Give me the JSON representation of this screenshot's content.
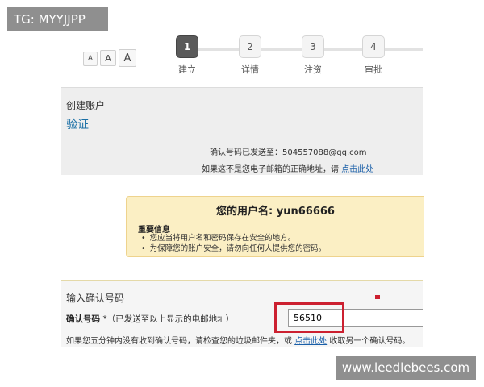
{
  "watermark_top": "TG: MYYJJPP",
  "watermark_bottom": "www.leedlebees.com",
  "font_size_buttons": [
    "A",
    "A",
    "A"
  ],
  "steps": [
    {
      "num": "1",
      "label": "建立"
    },
    {
      "num": "2",
      "label": "详情"
    },
    {
      "num": "3",
      "label": "注资"
    },
    {
      "num": "4",
      "label": "审批"
    }
  ],
  "create_account": {
    "title": "创建账户",
    "verify": "验证",
    "sent_label": "确认号码已发送至：",
    "email": "504557088@qq.com",
    "wrong_prefix": "如果这不是您电子邮箱的正确地址，请 ",
    "wrong_link": "点击此处"
  },
  "info": {
    "username_label": "您的用户名: ",
    "username": "yun66666",
    "heading": "重要信息",
    "items": [
      "您应当将用户名和密码保存在安全的地方。",
      "为保障您的账户安全，请勿向任何人提供您的密码。"
    ]
  },
  "confirm": {
    "title": "输入确认号码",
    "label": "确认号码",
    "hint": " *（已发送至以上显示的电邮地址）",
    "value": "56510",
    "help_prefix": "如果您五分钟内没有收到确认号码，请检查您的垃圾邮件夹，或 ",
    "help_link": "点击此处",
    "help_suffix": " 收取另一个确认号码。"
  },
  "colors": {
    "active_step": "#5a5a5a",
    "link": "#1a5fa8",
    "verify": "#1a6fa5",
    "info_bg": "#fbefc4",
    "highlight": "#cc2030"
  }
}
